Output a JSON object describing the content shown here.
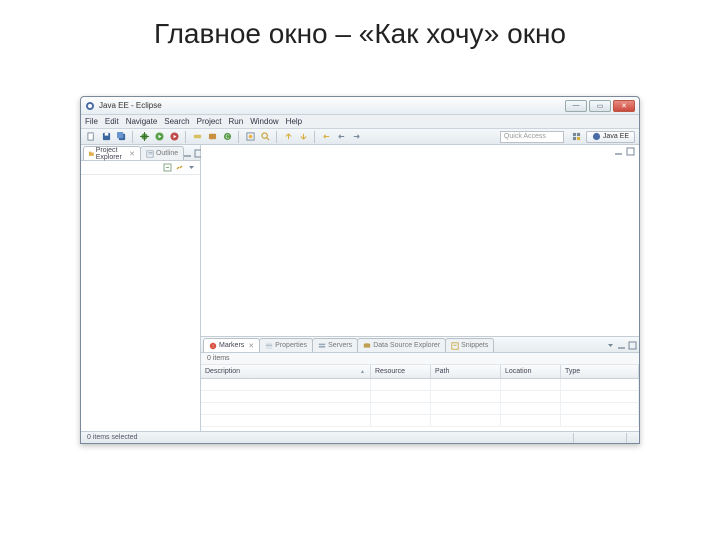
{
  "slide_title": "Главное окно – «Как хочу» окно",
  "window": {
    "title": "Java EE - Eclipse"
  },
  "menu": [
    "File",
    "Edit",
    "Navigate",
    "Search",
    "Project",
    "Run",
    "Window",
    "Help"
  ],
  "quick_access": {
    "placeholder": "Quick Access"
  },
  "perspective": {
    "open_label": "",
    "current": "Java EE"
  },
  "left": {
    "tabs": [
      {
        "label": "Project Explorer",
        "active": true
      },
      {
        "label": "Outline",
        "active": false
      }
    ]
  },
  "bottom": {
    "tabs": [
      {
        "label": "Markers",
        "active": true
      },
      {
        "label": "Properties",
        "active": false
      },
      {
        "label": "Servers",
        "active": false
      },
      {
        "label": "Data Source Explorer",
        "active": false
      },
      {
        "label": "Snippets",
        "active": false
      }
    ],
    "status": "0 items",
    "columns": [
      "Description",
      "Resource",
      "Path",
      "Location",
      "Type"
    ]
  },
  "statusbar": {
    "text": "0 items selected"
  }
}
